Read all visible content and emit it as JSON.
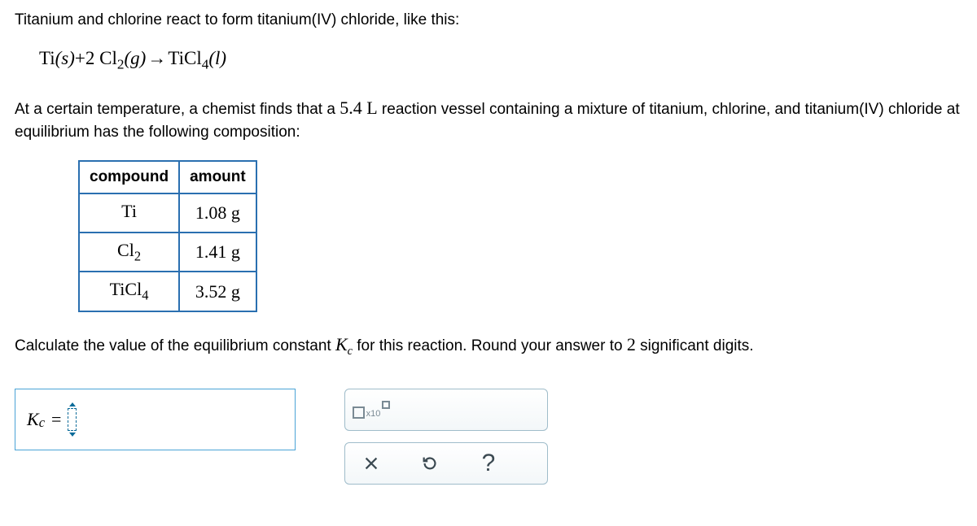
{
  "intro": "Titanium and chlorine react to form titanium(IV) chloride, like this:",
  "equation": {
    "r1_el": "Ti",
    "r1_state": "(s)",
    "plus": "+",
    "r2_coeff": "2",
    "r2_el": "Cl",
    "r2_sub": "2",
    "r2_state": "(g)",
    "arrow": "→",
    "p_el": "TiCl",
    "p_sub": "4",
    "p_state": "(l)"
  },
  "para1a": "At a certain temperature, a chemist finds that a ",
  "para1_num": "5.4 L",
  "para1b": " reaction vessel containing a mixture of titanium, chlorine, and titanium(IV) chloride at equilibrium has the following composition:",
  "table": {
    "h1": "compound",
    "h2": "amount",
    "rows": [
      {
        "formula_base": "Ti",
        "formula_sub": "",
        "amount": "1.08 g"
      },
      {
        "formula_base": "Cl",
        "formula_sub": "2",
        "amount": "1.41 g"
      },
      {
        "formula_base": "TiCl",
        "formula_sub": "4",
        "amount": "3.52 g"
      }
    ]
  },
  "prompt_a": "Calculate the value of the equilibrium constant ",
  "prompt_k": "K",
  "prompt_k_sub": "c",
  "prompt_b": " for this reaction. Round your answer to ",
  "prompt_sig": "2",
  "prompt_c": " significant digits.",
  "answer": {
    "k": "K",
    "sub": "c",
    "equals": "="
  },
  "toolbox": {
    "sci_times": "x10",
    "help": "?"
  }
}
